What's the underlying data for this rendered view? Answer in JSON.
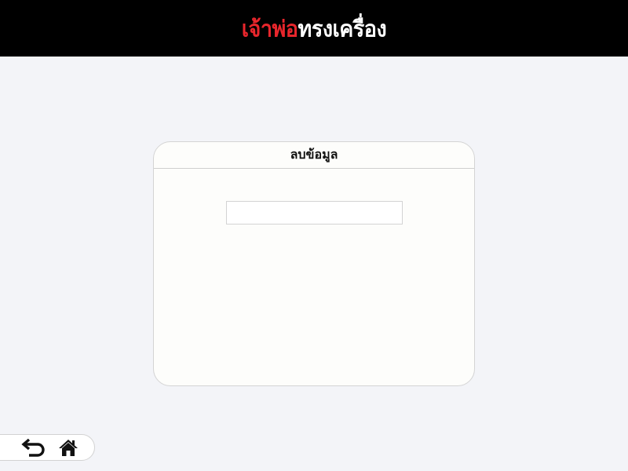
{
  "header": {
    "logo_part1": "เจ้าพ่อ",
    "logo_part2": "ทรงเครื่อง"
  },
  "dialog": {
    "title": "ลบข้อมูล",
    "input_value": ""
  },
  "nav": {
    "back_icon": "back-arrow-icon",
    "home_icon": "home-icon"
  },
  "colors": {
    "header_bg": "#000000",
    "logo_red": "#e8262c",
    "logo_white": "#ffffff",
    "page_bg": "#f3f4f8",
    "dialog_bg": "#fdfdfb"
  }
}
